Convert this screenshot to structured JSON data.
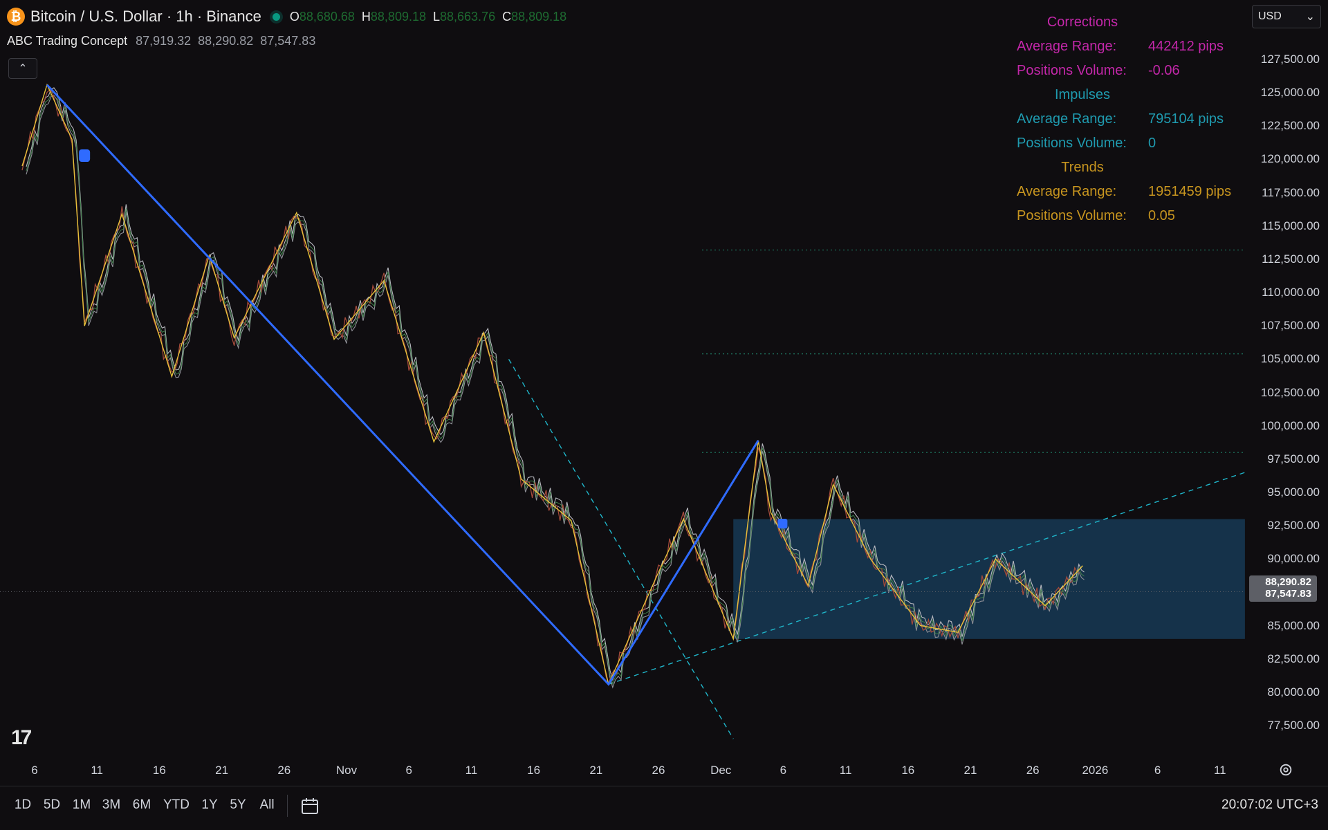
{
  "header": {
    "logo_glyph": "₿",
    "symbol_title": "Bitcoin / U.S. Dollar · 1h · Binance",
    "ohlc": [
      {
        "label": "O",
        "value": "88,680.68"
      },
      {
        "label": "H",
        "value": "88,809.18"
      },
      {
        "label": "L",
        "value": "88,663.76"
      },
      {
        "label": "C",
        "value": "88,809.18"
      }
    ],
    "indicator": {
      "name": "ABC Trading Concept",
      "values": [
        "87,919.32",
        "88,290.82",
        "87,547.83"
      ]
    },
    "collapse_glyph": "⌃"
  },
  "currency": {
    "label": "USD",
    "chevron": "⌄"
  },
  "stats": {
    "corrections": {
      "title": "Corrections",
      "avg_range_label": "Average Range:",
      "avg_range": "442412 pips",
      "volume_label": "Positions Volume:",
      "volume": "-0.06"
    },
    "impulses": {
      "title": "Impulses",
      "avg_range_label": "Average Range:",
      "avg_range": "795104 pips",
      "volume_label": "Positions Volume:",
      "volume": "0"
    },
    "trends": {
      "title": "Trends",
      "avg_range_label": "Average Range:",
      "avg_range": "1951459 pips",
      "volume_label": "Positions Volume:",
      "volume": "0.05"
    }
  },
  "price_axis": [
    "127,500.00",
    "125,000.00",
    "122,500.00",
    "120,000.00",
    "117,500.00",
    "115,000.00",
    "112,500.00",
    "110,000.00",
    "107,500.00",
    "105,000.00",
    "102,500.00",
    "100,000.00",
    "97,500.00",
    "95,000.00",
    "92,500.00",
    "90,000.00",
    "85,000.00",
    "82,500.00",
    "80,000.00",
    "77,500.00"
  ],
  "last_price": {
    "high_label": "88,290.82",
    "price": "87,547.83"
  },
  "time_axis": [
    "6",
    "11",
    "16",
    "21",
    "26",
    "Nov",
    "6",
    "11",
    "16",
    "21",
    "26",
    "Dec",
    "6",
    "11",
    "16",
    "21",
    "26",
    "2026",
    "6",
    "11"
  ],
  "ranges": [
    "1D",
    "5D",
    "1M",
    "3M",
    "6M",
    "YTD",
    "1Y",
    "5Y",
    "All"
  ],
  "clock": "20:07:02 UTC+3",
  "logo_text": "17",
  "colors": {
    "background": "#0f0d10",
    "trend_line": "#2f6bff",
    "zigzag": "#e6c13a",
    "channel_dashed": "#1fb5c9",
    "range_box": "#163a55",
    "corrections": "#c327a9",
    "impulses": "#1f9bb0",
    "trends": "#c7951f",
    "ohlc_values": "#1e6b31"
  },
  "chart_data": {
    "type": "line",
    "x_range": [
      "Oct 6",
      "Jan 11 2026"
    ],
    "ylim": [
      76000,
      129000
    ],
    "trend_line": [
      {
        "x": "Oct 7",
        "y": 125600
      },
      {
        "x": "Nov 21",
        "y": 80600
      },
      {
        "x": "Dec 3",
        "y": 98900
      }
    ],
    "zigzag": [
      {
        "x": "Oct 5",
        "y": 119500
      },
      {
        "x": "Oct 7",
        "y": 125600
      },
      {
        "x": "Oct 9",
        "y": 121500
      },
      {
        "x": "Oct 10",
        "y": 107500
      },
      {
        "x": "Oct 13",
        "y": 115900
      },
      {
        "x": "Oct 17",
        "y": 103700
      },
      {
        "x": "Oct 20",
        "y": 112800
      },
      {
        "x": "Oct 22",
        "y": 106600
      },
      {
        "x": "Oct 27",
        "y": 116000
      },
      {
        "x": "Oct 30",
        "y": 106500
      },
      {
        "x": "Nov 3",
        "y": 110900
      },
      {
        "x": "Nov 7",
        "y": 98800
      },
      {
        "x": "Nov 11",
        "y": 107000
      },
      {
        "x": "Nov 14",
        "y": 96000
      },
      {
        "x": "Nov 18",
        "y": 92900
      },
      {
        "x": "Nov 21",
        "y": 80600
      },
      {
        "x": "Nov 25",
        "y": 89000
      },
      {
        "x": "Nov 27",
        "y": 93000
      },
      {
        "x": "Dec 1",
        "y": 84000
      },
      {
        "x": "Dec 3",
        "y": 98900
      },
      {
        "x": "Dec 4",
        "y": 93500
      },
      {
        "x": "Dec 7",
        "y": 88000
      },
      {
        "x": "Dec 9",
        "y": 95600
      },
      {
        "x": "Dec 12",
        "y": 90000
      },
      {
        "x": "Dec 16",
        "y": 85000
      },
      {
        "x": "Dec 19",
        "y": 84500
      },
      {
        "x": "Dec 22",
        "y": 90000
      },
      {
        "x": "Dec 26",
        "y": 86500
      },
      {
        "x": "Dec 29",
        "y": 89500
      }
    ],
    "range_box": {
      "x_start": "Dec 1",
      "x_end": "Jan 11 2026",
      "y_low": 84000,
      "y_high": 93000
    },
    "dotted_levels": [
      113200,
      105400,
      98000
    ],
    "channel_lines": [
      {
        "from": {
          "x": "Nov 21",
          "y": 80600
        },
        "to": {
          "x": "Jan 11 2026",
          "y": 96500
        }
      },
      {
        "from": {
          "x": "Nov 13",
          "y": 105000
        },
        "to": {
          "x": "Dec 1",
          "y": 76500
        }
      }
    ],
    "last_price": 87547.83
  }
}
